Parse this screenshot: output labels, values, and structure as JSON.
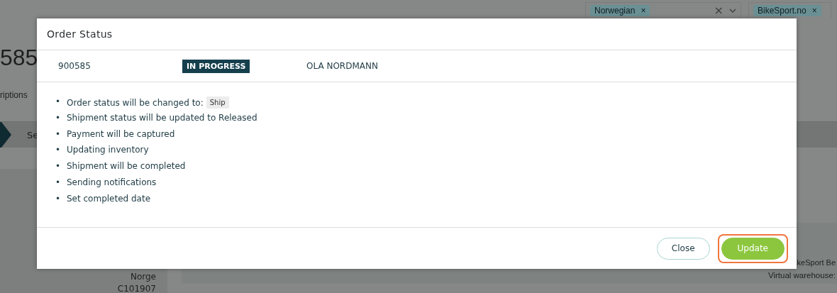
{
  "background": {
    "language_tags": [
      {
        "label": "Norwegian",
        "remove": "×"
      }
    ],
    "language_clear": "×",
    "store_tags": [
      {
        "label": "BikeSport.no",
        "remove": "×"
      }
    ],
    "order_number": "585",
    "tab": "riptions",
    "step": "Se",
    "address_country": "Norge",
    "customer_id": "C101907",
    "store_name": "keSport Be",
    "warehouse_label": "Virtual warehouse:"
  },
  "dialog": {
    "title": "Order Status",
    "order": {
      "number": "900585",
      "status": "IN PROGRESS",
      "customer": "OLA NORDMANN"
    },
    "changes": [
      {
        "marker": "•",
        "text": "Order status will be changed to:",
        "tag": "Ship"
      },
      {
        "marker": "•",
        "text": "Shipment status will be updated to Released"
      },
      {
        "marker": "•",
        "text": "Payment will be captured"
      },
      {
        "marker": "•",
        "text": "Updating inventory"
      },
      {
        "marker": "•",
        "text": "Shipment will be completed"
      },
      {
        "marker": "•",
        "text": "Sending notifications"
      },
      {
        "marker": "•",
        "text": "Set completed date"
      }
    ],
    "buttons": [
      {
        "label": "Close",
        "kind": "secondary",
        "highlighted": false
      },
      {
        "label": "Update",
        "kind": "primary",
        "highlighted": true
      }
    ]
  }
}
